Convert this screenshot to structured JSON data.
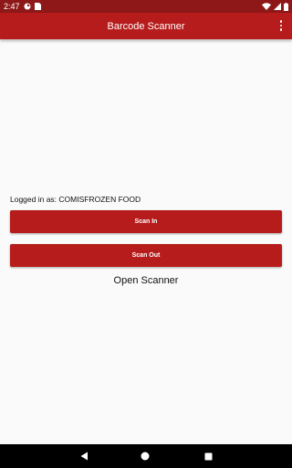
{
  "status_bar": {
    "time": "2:47",
    "icons": [
      "sync-icon",
      "sim-icon",
      "wifi-icon",
      "signal-icon",
      "battery-icon"
    ]
  },
  "app_bar": {
    "title": "Barcode Scanner",
    "menu_icon": "more-vert-icon"
  },
  "main": {
    "logged_in_text": "Logged in as: COMISFROZEN FOOD",
    "scan_in_label": "Scan In",
    "scan_out_label": "Scan Out",
    "open_scanner_label": "Open Scanner"
  },
  "nav_bar": {
    "icons": [
      "back-icon",
      "home-icon",
      "recents-icon"
    ]
  },
  "colors": {
    "status_bar": "#8e1818",
    "primary": "#b71c1c",
    "background": "#fafafa"
  }
}
